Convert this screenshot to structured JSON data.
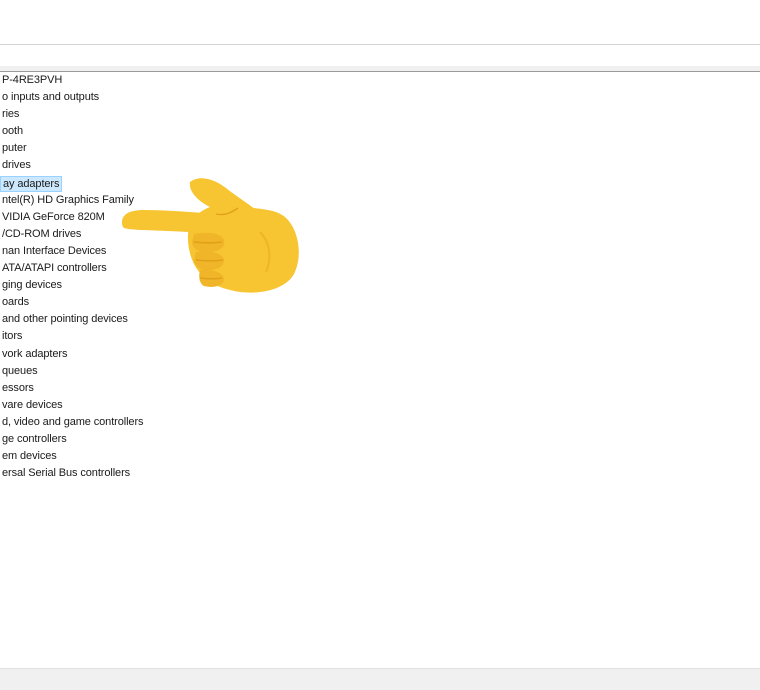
{
  "device_tree": {
    "items": [
      {
        "label": "P-4RE3PVH",
        "selected": false
      },
      {
        "label": "o inputs and outputs",
        "selected": false
      },
      {
        "label": "ries",
        "selected": false
      },
      {
        "label": "ooth",
        "selected": false
      },
      {
        "label": "puter",
        "selected": false
      },
      {
        "label": "drives",
        "selected": false
      },
      {
        "label": "ay adapters",
        "selected": true
      },
      {
        "label": "ntel(R) HD Graphics Family",
        "selected": false
      },
      {
        "label": "VIDIA GeForce 820M",
        "selected": false
      },
      {
        "label": "/CD-ROM drives",
        "selected": false
      },
      {
        "label": "nan Interface Devices",
        "selected": false
      },
      {
        "label": "ATA/ATAPI controllers",
        "selected": false
      },
      {
        "label": "ging devices",
        "selected": false
      },
      {
        "label": "oards",
        "selected": false
      },
      {
        "label": " and other pointing devices",
        "selected": false
      },
      {
        "label": "itors",
        "selected": false
      },
      {
        "label": "vork adapters",
        "selected": false
      },
      {
        "label": " queues",
        "selected": false
      },
      {
        "label": "essors",
        "selected": false
      },
      {
        "label": "vare devices",
        "selected": false
      },
      {
        "label": "d, video and game controllers",
        "selected": false
      },
      {
        "label": "ge controllers",
        "selected": false
      },
      {
        "label": "em devices",
        "selected": false
      },
      {
        "label": "ersal Serial Bus controllers",
        "selected": false
      }
    ]
  },
  "overlay": {
    "icon": "backhand-index-pointing-left-icon",
    "skin_color": "#f7c531",
    "shade_color": "#e0a01a"
  },
  "colors": {
    "selection_bg": "#cce8ff",
    "selection_border": "#99d1ff",
    "text": "#1a1a1a"
  }
}
